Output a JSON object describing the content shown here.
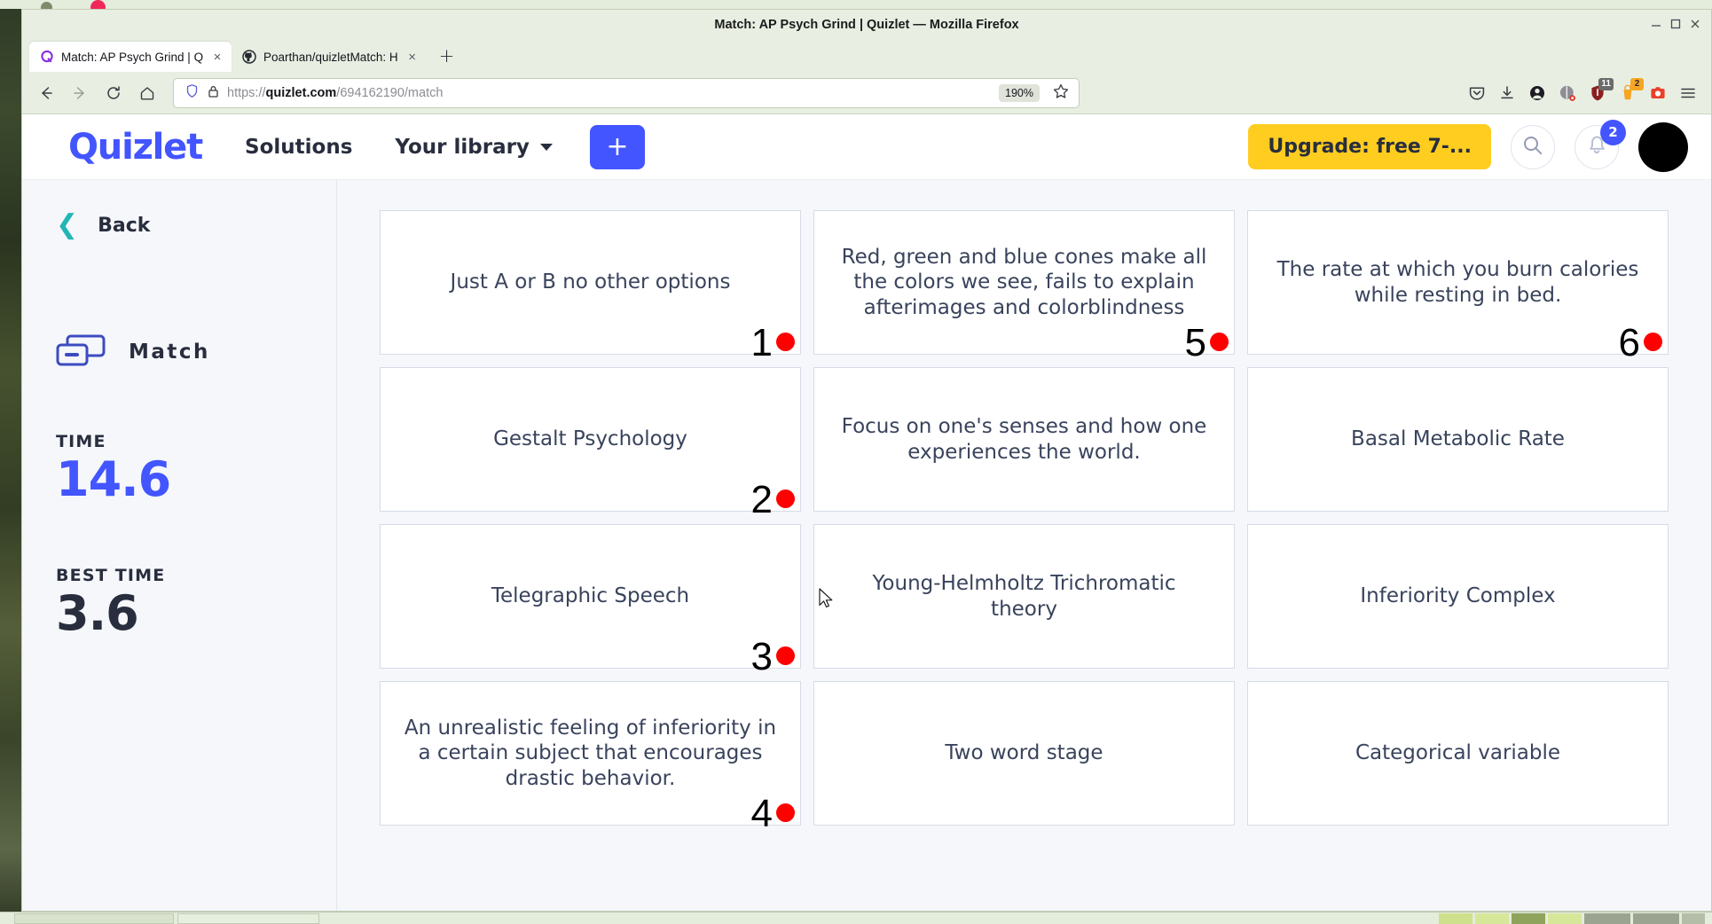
{
  "window": {
    "title": "Match: AP Psych Grind | Quizlet — Mozilla Firefox",
    "controls": [
      "minimize-icon",
      "maximize-icon",
      "close-icon"
    ]
  },
  "tabs": [
    {
      "label": "Match: AP Psych Grind | Q",
      "favicon": "quizlet-favicon",
      "close": "×",
      "active": true
    },
    {
      "label": "Poarthan/quizletMatch: H",
      "favicon": "github-favicon",
      "close": "×",
      "active": false
    }
  ],
  "new_tab_label": "+",
  "toolbar": {
    "back_icon": "back-arrow-icon",
    "forward_icon": "forward-arrow-icon",
    "reload_icon": "reload-icon",
    "home_icon": "home-icon",
    "shield_icon": "shield-icon",
    "lock_icon": "lock-icon",
    "url_protocol": "https://",
    "url_host": "quizlet.com",
    "url_path": "/694162190/match",
    "url_full": "https://quizlet.com/694162190/match",
    "zoom_level": "190%",
    "bookmark_icon": "star-icon",
    "extensions": [
      {
        "name": "pocket-icon",
        "badge": "",
        "badge_color": ""
      },
      {
        "name": "downloads-icon",
        "badge": "",
        "badge_color": ""
      },
      {
        "name": "account-icon",
        "badge": "",
        "badge_color": ""
      },
      {
        "name": "no-script-icon",
        "badge": "",
        "badge_color": ""
      },
      {
        "name": "ublock-origin-icon",
        "badge": "11",
        "badge_color": "#6b6b6b"
      },
      {
        "name": "honey-icon",
        "badge": "2",
        "badge_color": "#f6a623"
      },
      {
        "name": "screenshot-icon",
        "badge": "",
        "badge_color": ""
      },
      {
        "name": "app-menu-icon",
        "badge": "",
        "badge_color": ""
      }
    ]
  },
  "site_header": {
    "logo": "Quizlet",
    "nav": [
      {
        "label": "Solutions",
        "has_chevron": false
      },
      {
        "label": "Your library",
        "has_chevron": true
      }
    ],
    "create_label": "+",
    "upgrade_label": "Upgrade: free 7-...",
    "search_icon": "search-icon",
    "bell_icon": "bell-icon",
    "bell_badge": "2",
    "avatar": "user-avatar",
    "brand_color": "#4255ff",
    "upgrade_color": "#ffcd1f"
  },
  "sidebar": {
    "back_label": "Back",
    "back_icon": "chevron-left-icon",
    "mode_icon": "match-mode-icon",
    "mode_label": "Match",
    "stats": [
      {
        "label": "TIME",
        "value": "14.6",
        "color": "#4255ff"
      },
      {
        "label": "BEST TIME",
        "value": "3.6",
        "color": "#282e3e"
      }
    ]
  },
  "cards": [
    {
      "text": "Just A or B no other options",
      "marker": "1"
    },
    {
      "text": "Red, green and blue cones make all the colors we see, fails to explain afterimages and colorblindness",
      "marker": "5"
    },
    {
      "text": "The rate at which you burn calories while resting in bed.",
      "marker": "6"
    },
    {
      "text": "Gestalt Psychology",
      "marker": "2"
    },
    {
      "text": "Focus on one's senses and how one experiences the world.",
      "marker": ""
    },
    {
      "text": "Basal Metabolic Rate",
      "marker": ""
    },
    {
      "text": "Telegraphic Speech",
      "marker": "3"
    },
    {
      "text": "Young-Helmholtz Trichromatic theory",
      "marker": ""
    },
    {
      "text": "Inferiority Complex",
      "marker": ""
    },
    {
      "text": "An unrealistic feeling of inferiority in a certain subject that encourages drastic behavior.",
      "marker": "4"
    },
    {
      "text": "Two word stage",
      "marker": ""
    },
    {
      "text": "Categorical variable",
      "marker": ""
    }
  ],
  "marker_color": "#fe0000",
  "cursor": "mouse-pointer"
}
